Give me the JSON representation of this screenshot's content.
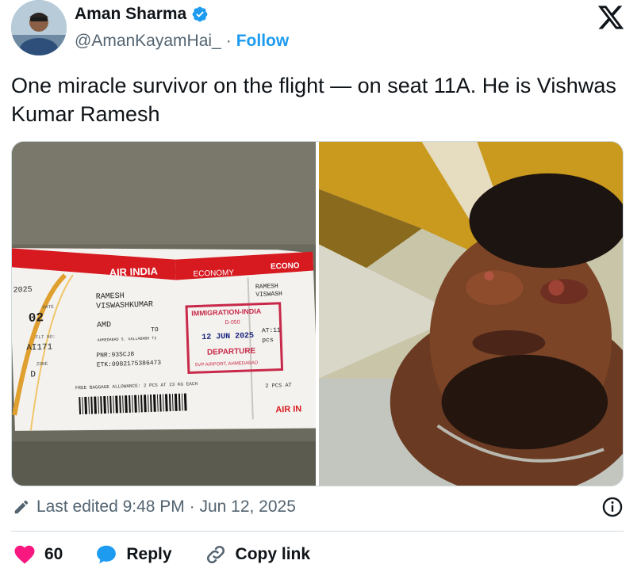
{
  "author": {
    "display_name": "Aman Sharma",
    "handle": "@AmanKayamHai_",
    "separator": "·",
    "follow_label": "Follow"
  },
  "tweet": {
    "text": "One miracle survivor on the flight — on seat 11A. He is Vishwas Kumar Ramesh"
  },
  "ticket": {
    "airline": "AIR INDIA",
    "class": "ECONOMY",
    "class_stub": "ECONO",
    "year": "2025",
    "gate_label": "GATE",
    "gate": "02",
    "flt_label": "FLT NO:",
    "flight": "AI171",
    "zone_label": "ZONE",
    "zone": "D",
    "passenger_last": "RAMESH",
    "passenger_first": "VISWASHKUMAR",
    "from": "AMD",
    "to_label": "TO",
    "airport_line": "AHMEDABAD S. VALLABHBH T2",
    "pnr": "PNR:93SCJ8",
    "etk": "ETK:0982175386473",
    "stamp_title": "IMMIGRATION-INDIA",
    "stamp_code": "D-050",
    "stamp_date": "12 JUN 2025",
    "stamp_departure": "DEPARTURE",
    "stamp_airport": "SVP AIRPORT, AHMEDABAD",
    "baggage": "FREE BAGGAGE ALLOWANCE: 2 PCS AT 23 KG EACH",
    "stub_name": "RAMESH",
    "stub_name2": "VISWASH",
    "stub_seat": "AT:11",
    "stub_pcs": "pcs",
    "stub_bag": "2 PCS AT",
    "stub_logo": "AIR IN"
  },
  "meta": {
    "edited": "Last edited 9:48 PM · Jun 12, 2025"
  },
  "actions": {
    "like_count": "60",
    "reply_label": "Reply",
    "copy_label": "Copy link"
  },
  "colors": {
    "accent": "#1d9bf0",
    "like": "#f91880",
    "air_india_red": "#d71920"
  }
}
